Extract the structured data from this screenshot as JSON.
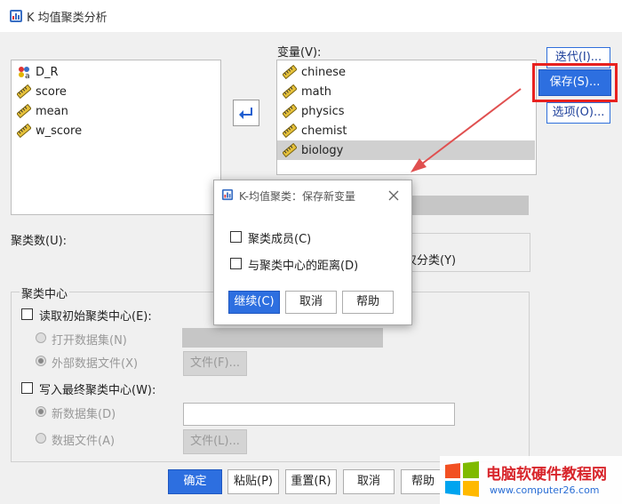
{
  "window": {
    "title": "K 均值聚类分析"
  },
  "source_vars": [
    {
      "name": "D_R",
      "icon": "nominal-variable-icon"
    },
    {
      "name": "score",
      "icon": "scale-variable-icon"
    },
    {
      "name": "mean",
      "icon": "scale-variable-icon"
    },
    {
      "name": "w_score",
      "icon": "scale-variable-icon"
    }
  ],
  "variables": {
    "label": "变量(V):",
    "items": [
      {
        "name": "chinese"
      },
      {
        "name": "math"
      },
      {
        "name": "physics"
      },
      {
        "name": "chemist"
      },
      {
        "name": "biology",
        "selected": true
      }
    ]
  },
  "side_buttons": {
    "iterate": "迭代(I)...",
    "save": "保存(S)...",
    "options": "选项(O)..."
  },
  "cluster_count": {
    "label": "聚类数(U):",
    "method_tail": "仅分类(Y)"
  },
  "centers": {
    "group_title": "聚类中心",
    "read_initial": "读取初始聚类中心(E):",
    "open_dataset": "打开数据集(N)",
    "external_file": "外部数据文件(X)",
    "file_btn1": "文件(F)...",
    "write_final": "写入最终聚类中心(W):",
    "new_dataset": "新数据集(D)",
    "data_file": "数据文件(A)",
    "file_btn2": "文件(L)..."
  },
  "bottom_buttons": {
    "ok": "确定",
    "paste": "粘贴(P)",
    "reset": "重置(R)",
    "cancel": "取消",
    "help": "帮助"
  },
  "dialog": {
    "title": "K-均值聚类：保存新变量",
    "option1": "聚类成员(C)",
    "option2": "与聚类中心的距离(D)",
    "continue": "继续(C)",
    "cancel": "取消",
    "help": "帮助"
  },
  "watermark": {
    "name": "电脑软硬件教程网",
    "url": "www.computer26.com"
  },
  "colors": {
    "accent": "#2d6fe0",
    "highlight": "#e8211f",
    "arrow": "#e05050"
  }
}
